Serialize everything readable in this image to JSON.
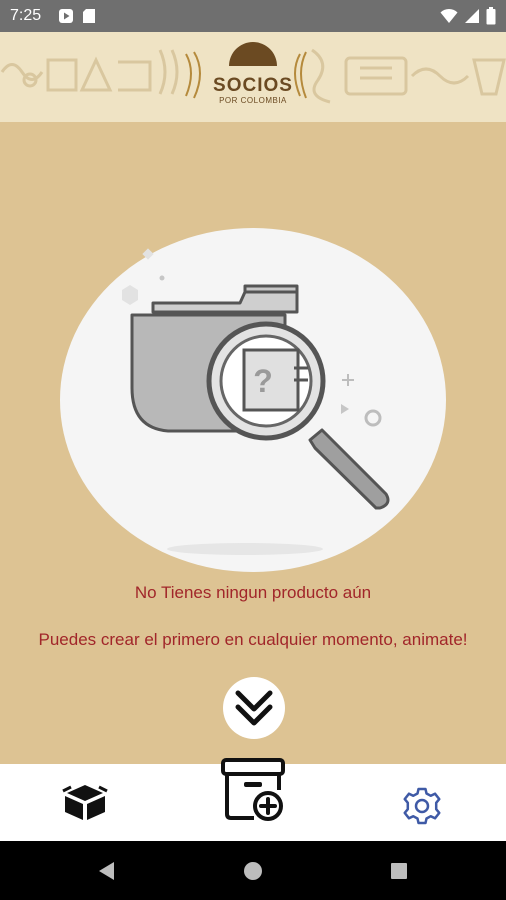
{
  "status_bar": {
    "time": "7:25",
    "icons_left": [
      "play-store-icon",
      "sd-card-icon"
    ],
    "icons_right": [
      "wifi-icon",
      "signal-icon",
      "battery-icon"
    ]
  },
  "header_banner": {
    "brand_line1": "SOCIOS",
    "brand_line2": "POR COLOMBIA",
    "brand_color": "#6b4a22"
  },
  "empty_state": {
    "title": "No Tienes ningun producto aún",
    "subtitle": "Puedes crear el primero en cualquier momento, animate!",
    "text_color": "#a1262a",
    "illustration_icon": "folder-search-icon"
  },
  "scroll_button": {
    "icon": "double-chevron-down-icon"
  },
  "bottom_nav": {
    "items": [
      {
        "icon": "box-icon",
        "active": true
      },
      {
        "icon": "archive-add-icon"
      },
      {
        "icon": "gear-icon",
        "color": "#3f5aa6"
      }
    ]
  },
  "colors": {
    "background": "#ddc393",
    "banner_bg": "#efe3c4",
    "status_bar": "#6f6f6f",
    "nav_bg": "#ffffff",
    "system_nav": "#000000"
  }
}
